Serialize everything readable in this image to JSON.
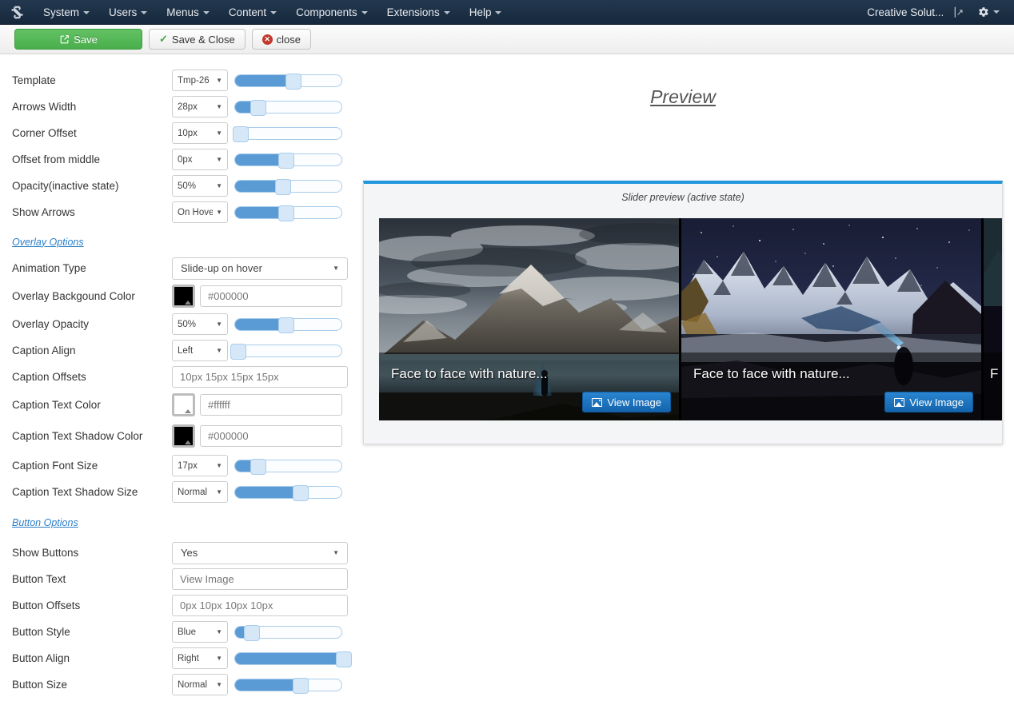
{
  "adminbar": {
    "logo_icon": "joomla-logo-icon",
    "menus": [
      {
        "label": "System"
      },
      {
        "label": "Users"
      },
      {
        "label": "Menus"
      },
      {
        "label": "Content"
      },
      {
        "label": "Components"
      },
      {
        "label": "Extensions"
      },
      {
        "label": "Help"
      }
    ],
    "site_name": "Creative Solut...",
    "external_link_icon": "external-link-icon",
    "gear_icon": "gear-icon"
  },
  "toolbar": {
    "save_label": "Save",
    "save_close_label": "Save & Close",
    "close_label": "close"
  },
  "form": {
    "rows": [
      {
        "label": "Template",
        "value": "Tmp-26",
        "slider": 55
      },
      {
        "label": "Arrows Width",
        "value": "28px",
        "slider": 22
      },
      {
        "label": "Corner Offset",
        "value": "10px",
        "slider": 5
      },
      {
        "label": "Offset from middle",
        "value": "0px",
        "slider": 48
      },
      {
        "label": "Opacity(inactive state)",
        "value": "50%",
        "slider": 45
      },
      {
        "label": "Show Arrows",
        "value": "On Hove",
        "slider": 48
      }
    ],
    "overlay_section": "Overlay Options",
    "overlay": {
      "animation_label": "Animation Type",
      "animation_value": "Slide-up on hover",
      "bgcolor_label": "Overlay Backgound Color",
      "bgcolor_value": "#000000",
      "bgcolor_swatch": "#000000",
      "opacity_label": "Overlay Opacity",
      "opacity_value": "50%",
      "opacity_slider": 48,
      "align_label": "Caption Align",
      "align_value": "Left",
      "align_slider": 3,
      "offsets_label": "Caption Offsets",
      "offsets_value": "10px 15px 15px 15px",
      "textcolor_label": "Caption Text Color",
      "textcolor_value": "#ffffff",
      "textcolor_swatch": "#ffffff",
      "shadowcolor_label": "Caption Text Shadow Color",
      "shadowcolor_value": "#000000",
      "shadowcolor_swatch": "#000000",
      "fontsize_label": "Caption Font Size",
      "fontsize_value": "17px",
      "fontsize_slider": 22,
      "shadowsize_label": "Caption Text Shadow Size",
      "shadowsize_value": "Normal",
      "shadowsize_slider": 62
    },
    "button_section": "Button Options",
    "button": {
      "show_label": "Show Buttons",
      "show_value": "Yes",
      "text_label": "Button Text",
      "text_value": "View Image",
      "offsets_label": "Button Offsets",
      "offsets_value": "0px 10px 10px 10px",
      "style_label": "Button Style",
      "style_value": "Blue",
      "style_slider": 16,
      "align_label": "Button Align",
      "align_value": "Right",
      "align_slider": 95,
      "size_label": "Button Size",
      "size_value": "Normal",
      "size_slider": 62
    }
  },
  "preview": {
    "title": "Preview",
    "subtitle": "Slider preview (active state)",
    "close_icon": "close-icon",
    "close_glyph": "✕",
    "slides": [
      {
        "caption": "Face to face with nature...",
        "button": "View Image",
        "button_icon": "image-icon"
      },
      {
        "caption": "Face to face with nature...",
        "button": "View Image",
        "button_icon": "image-icon"
      },
      {
        "caption": "F",
        "button": "",
        "button_icon": "image-icon"
      }
    ]
  },
  "colors": {
    "adminbar_bg": "#1a2c42",
    "save_green": "#49ae4b",
    "accent_blue": "#2196dd",
    "slider_fill": "#5b9bd5",
    "link_blue": "#2a7fc9",
    "close_red": "#c9281c"
  }
}
